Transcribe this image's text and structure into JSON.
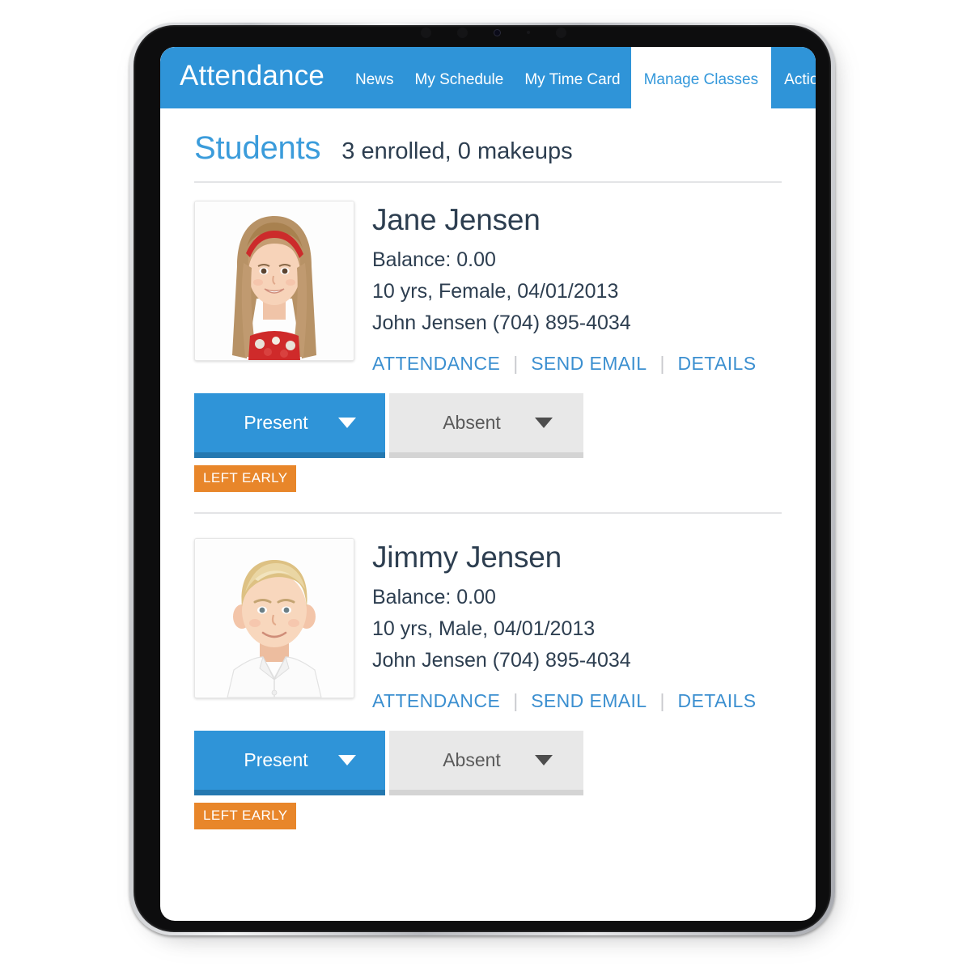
{
  "header": {
    "app_title": "Attendance",
    "nav": [
      {
        "label": "News",
        "active": false
      },
      {
        "label": "My Schedule",
        "active": false
      },
      {
        "label": "My Time Card",
        "active": false
      },
      {
        "label": "Manage Classes",
        "active": true
      }
    ],
    "actions_label": "Actions",
    "actions_icon": "chevron-down-icon",
    "colors": {
      "bar": "#2f94d8",
      "active_tab_text": "#3498db"
    }
  },
  "page": {
    "title": "Students",
    "subtitle": "3 enrolled, 0 makeups"
  },
  "links": {
    "attendance": "ATTENDANCE",
    "send_email": "SEND EMAIL",
    "details": "DETAILS",
    "separator": "|"
  },
  "buttons": {
    "present": "Present",
    "absent": "Absent",
    "caret_icon": "caret-down-icon",
    "colors": {
      "present": "#2f94d8",
      "present_shadow": "#2478b0",
      "absent": "#e8e8e8",
      "absent_shadow": "#d4d4d4"
    }
  },
  "badge": {
    "left_early": "LEFT EARLY",
    "color": "#e8862a"
  },
  "students": [
    {
      "name": "Jane Jensen",
      "balance": "Balance: 0.00",
      "demographics": "10 yrs, Female, 04/01/2013",
      "guardian": "John Jensen (704) 895-4034",
      "photo_alt": "girl-with-red-headband-photo"
    },
    {
      "name": "Jimmy Jensen",
      "balance": "Balance: 0.00",
      "demographics": "10 yrs, Male, 04/01/2013",
      "guardian": "John Jensen (704) 895-4034",
      "photo_alt": "boy-in-white-shirt-photo"
    }
  ]
}
